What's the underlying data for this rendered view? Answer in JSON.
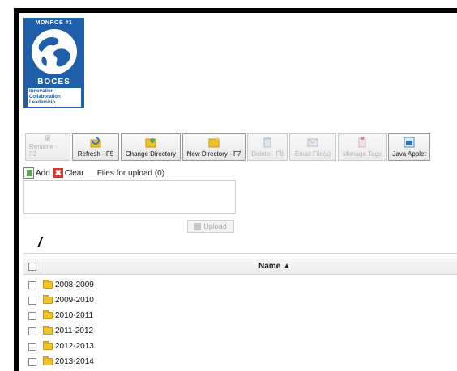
{
  "logo": {
    "top_text": "MONROE #1",
    "mid_text": "BOCES",
    "tagline": [
      "Innovation",
      "Collaboration",
      "Leadership"
    ]
  },
  "toolbar": {
    "buttons": [
      {
        "label": "Rename - F2",
        "icon": "rename-icon",
        "enabled": false
      },
      {
        "label": "Refresh - F5",
        "icon": "refresh-icon",
        "enabled": true
      },
      {
        "label": "Change Directory",
        "icon": "change-directory-icon",
        "enabled": true
      },
      {
        "label": "New Directory - F7",
        "icon": "new-directory-icon",
        "enabled": true
      },
      {
        "label": "Delete - F8",
        "icon": "delete-icon",
        "enabled": false
      },
      {
        "label": "Email File(s)",
        "icon": "email-icon",
        "enabled": false
      },
      {
        "label": "Manage Tags",
        "icon": "tags-icon",
        "enabled": false
      },
      {
        "label": "Java Applet",
        "icon": "java-applet-icon",
        "enabled": true
      }
    ]
  },
  "uploader": {
    "add_label": "Add",
    "clear_label": "Clear",
    "files_label": "Files for upload (0)",
    "upload_label": "Upload"
  },
  "path": "/",
  "grid": {
    "name_header": "Name ▲",
    "rows": [
      "2008-2009",
      "2009-2010",
      "2010-2011",
      "2011-2012",
      "2012-2013",
      "2013-2014"
    ]
  },
  "colors": {
    "logo_blue": "#1f5ea8",
    "folder_yellow": "#f2c229",
    "clear_red": "#d43a2f"
  }
}
